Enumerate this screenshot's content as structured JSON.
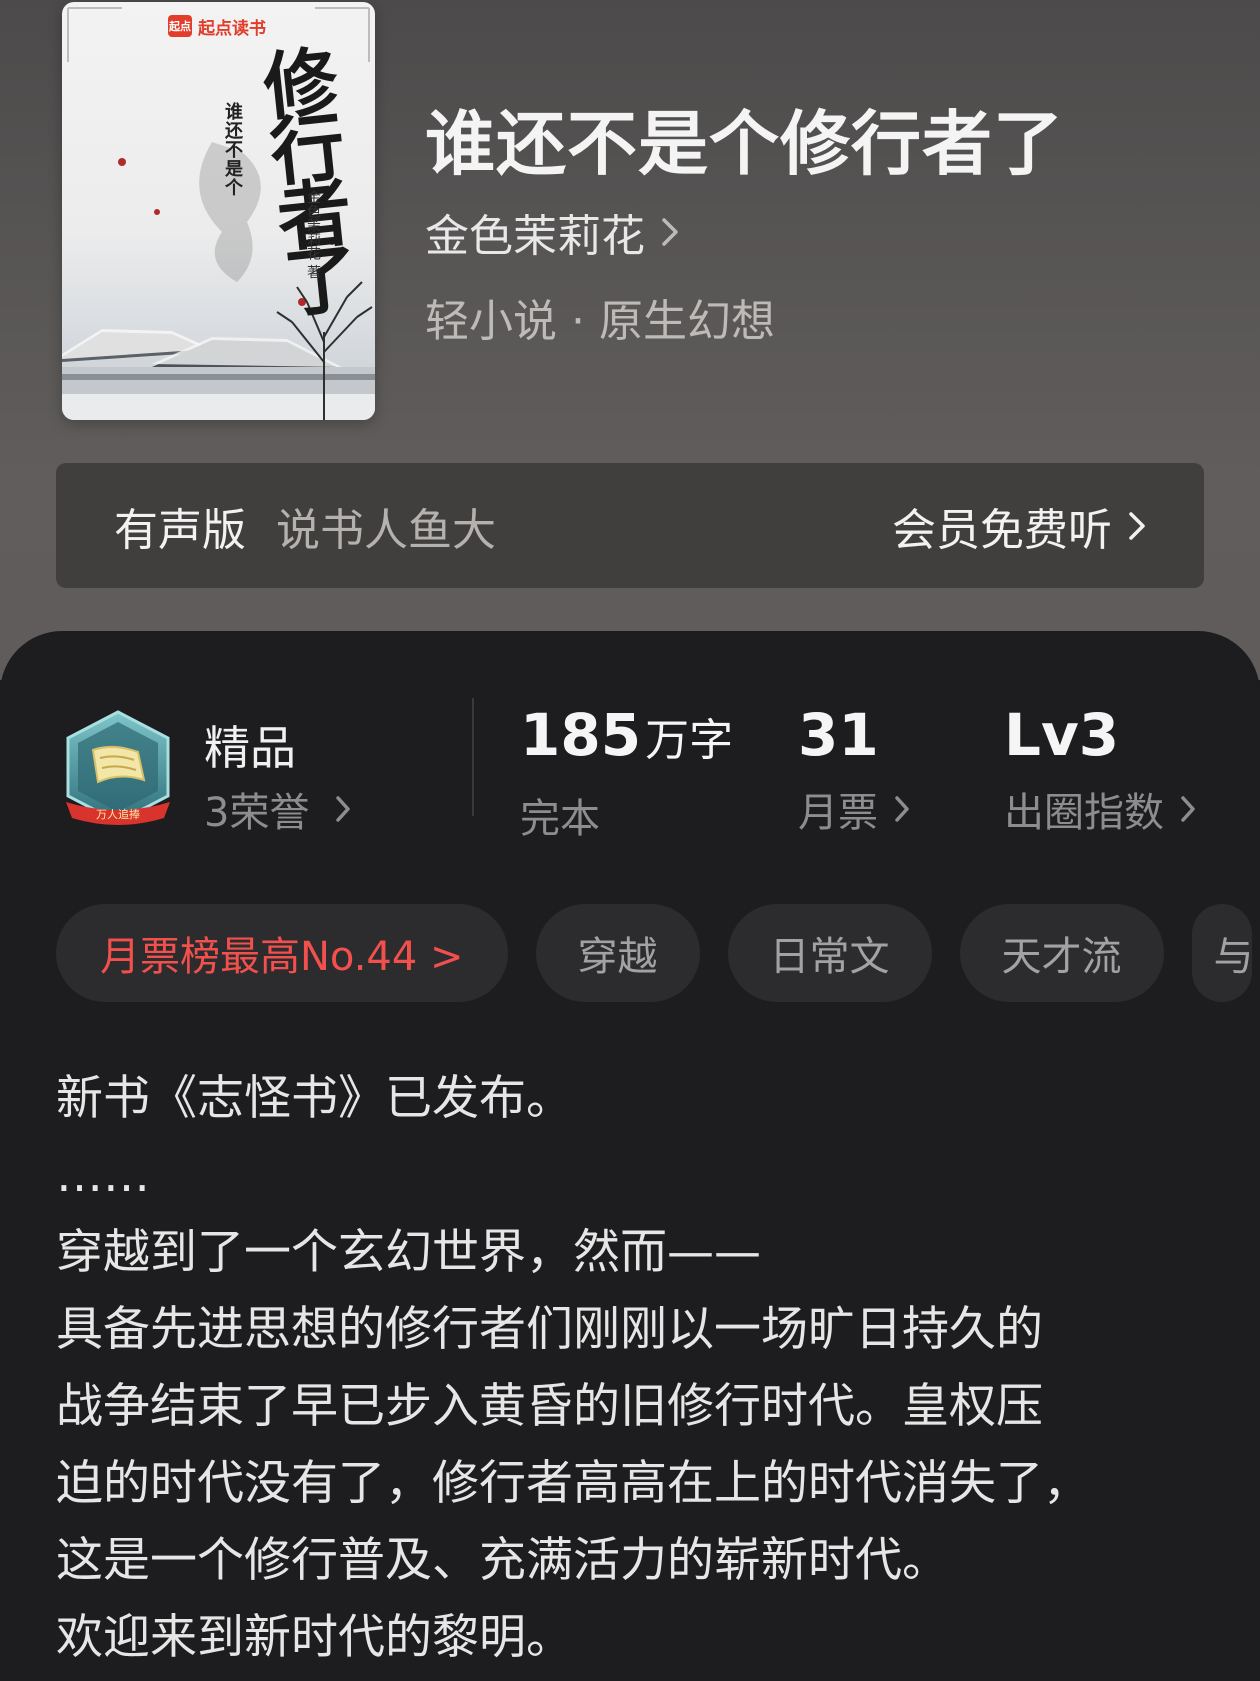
{
  "cover": {
    "logo_mark": "起点",
    "logo_text": "起点读书",
    "title_large": "修行者了",
    "title_small": "谁还不是个",
    "author": "金色茉莉花 著"
  },
  "book": {
    "title": "谁还不是个修行者了",
    "author": "金色茉莉花",
    "genre": "轻小说 · 原生幻想"
  },
  "audio": {
    "label": "有声版",
    "narrator": "说书人鱼大",
    "action": "会员免费听"
  },
  "honor": {
    "badge_text": "万人追捧",
    "name": "精品",
    "count": "3荣誉"
  },
  "stats": {
    "words_value": "185",
    "words_unit": "万字",
    "words_label": "完本",
    "tickets_value": "31",
    "tickets_label": "月票",
    "level_value": "Lv3",
    "level_label": "出圈指数"
  },
  "tags": {
    "rank": "月票榜最高No.44 >",
    "items": [
      "穿越",
      "日常文",
      "天才流"
    ],
    "partial": "与"
  },
  "description": [
    "新书《志怪书》已发布。",
    "……",
    "穿越到了一个玄幻世界，然而——",
    "具备先进思想的修行者们刚刚以一场旷日持久的",
    "战争结束了早已步入黄昏的旧修行时代。皇权压",
    "迫的时代没有了，修行者高高在上的时代消失了，",
    "这是一个修行普及、充满活力的崭新时代。",
    "欢迎来到新时代的黎明。"
  ],
  "colors": {
    "accent_red": "#f2504d",
    "card_bg": "#1d1d1f",
    "tag_bg": "#2c2c2e"
  },
  "icons": {
    "chevron": "chevron-right-icon",
    "badge": "honor-badge-icon"
  }
}
